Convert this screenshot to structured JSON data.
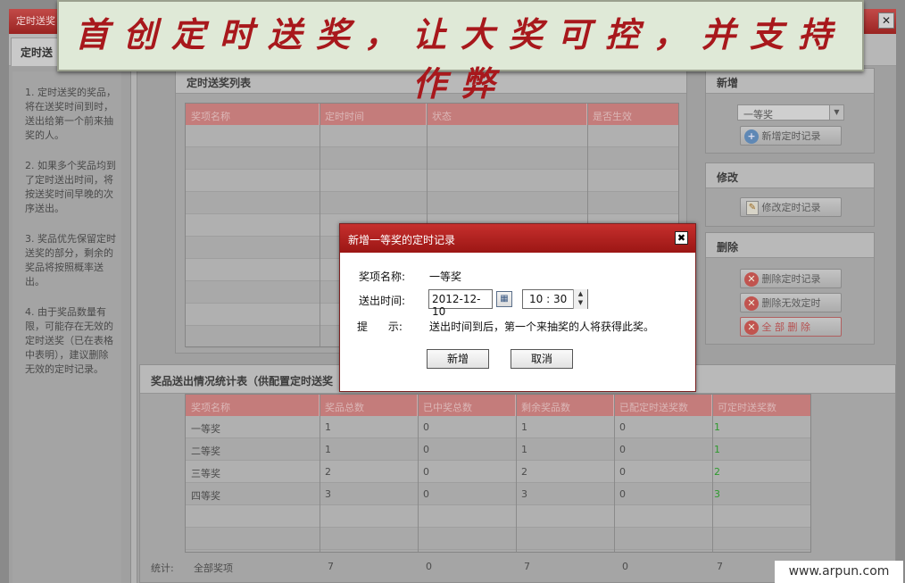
{
  "window": {
    "title": "定时送奖",
    "close_glyph": "✕",
    "active_tab": "定时送"
  },
  "banner": {
    "text": "首创定时送奖，让大奖可控，并支持作弊"
  },
  "notes": [
    "1. 定时送奖的奖品，将在送奖时间到时，送出给第一个前来抽奖的人。",
    "2. 如果多个奖品均到了定时送出时间，将按送奖时间早晚的次序送出。",
    "3. 奖品优先保留定时送奖的部分，剩余的奖品将按照概率送出。",
    "4. 由于奖品数量有限，可能存在无效的定时送奖（已在表格中表明），建议删除无效的定时记录。"
  ],
  "schedule_list": {
    "title": "定时送奖列表",
    "columns": [
      "奖项名称",
      "定时时间",
      "状态",
      "是否生效"
    ]
  },
  "side_panels": {
    "add": {
      "title": "新增",
      "prize_select": "一等奖",
      "add_button": "新增定时记录"
    },
    "edit": {
      "title": "修改",
      "edit_button": "修改定时记录"
    },
    "delete": {
      "title": "删除",
      "delete_button": "删除定时记录",
      "delete_invalid_button": "删除无效定时",
      "delete_all_button": "全 部 删 除"
    }
  },
  "stats": {
    "title": "奖品送出情况统计表（供配置定时送奖",
    "columns": [
      "奖项名称",
      "奖品总数",
      "已中奖总数",
      "剩余奖品数",
      "已配定时送奖数",
      "可定时送奖数"
    ],
    "rows": [
      [
        "一等奖",
        "1",
        "0",
        "1",
        "0",
        "1"
      ],
      [
        "二等奖",
        "1",
        "0",
        "1",
        "0",
        "1"
      ],
      [
        "三等奖",
        "2",
        "0",
        "2",
        "0",
        "2"
      ],
      [
        "四等奖",
        "3",
        "0",
        "3",
        "0",
        "3"
      ]
    ],
    "total_label": "统计:",
    "total_name": "全部奖项",
    "totals": [
      "7",
      "0",
      "7",
      "0",
      "7"
    ]
  },
  "dialog": {
    "title": "新增一等奖的定时记录",
    "close_glyph": "✖",
    "prize_label": "奖项名称:",
    "prize_value": "一等奖",
    "time_label": "送出时间:",
    "date_value": "2012-12-10",
    "time_value": "10 : 30",
    "hint_label": "提      示:",
    "hint_text": "送出时间到后，第一个来抽奖的人将获得此奖。",
    "ok_button": "新增",
    "cancel_button": "取消"
  },
  "watermark": "www.arpun.com"
}
